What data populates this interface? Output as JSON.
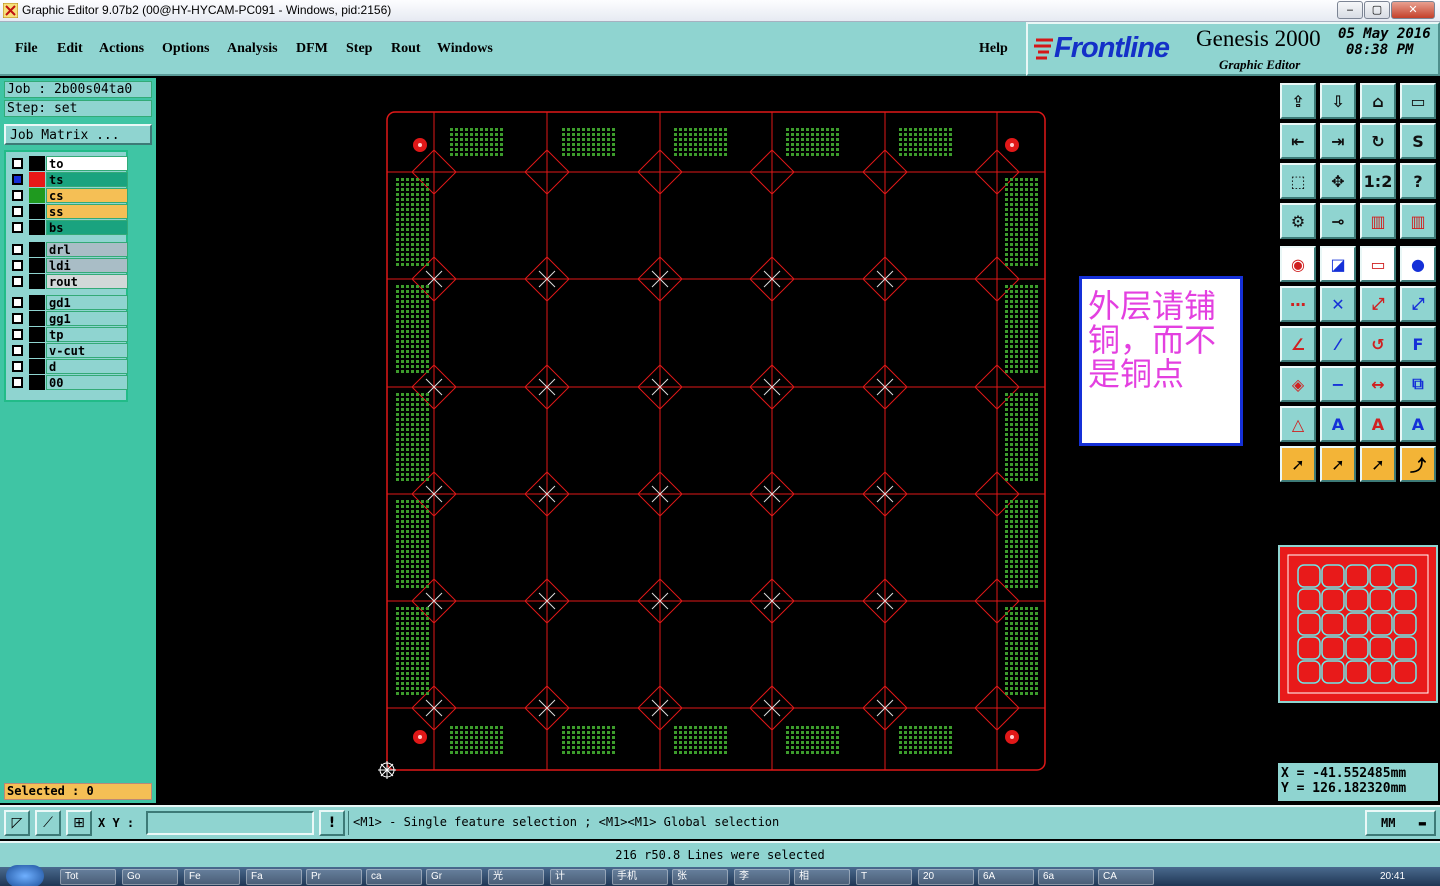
{
  "window": {
    "title": "Graphic Editor 9.07b2 (00@HY-HYCAM-PC091 - Windows, pid:2156)",
    "min": "‒",
    "max": "▢",
    "close": "✕"
  },
  "menu": {
    "items": [
      "File",
      "Edit",
      "Actions",
      "Options",
      "Analysis",
      "DFM",
      "Step",
      "Rout",
      "Windows"
    ],
    "help": "Help"
  },
  "brand": {
    "logo": "Frontline",
    "product": "Genesis 2000",
    "subtitle": "Graphic Editor",
    "date": "05 May 2016",
    "time": "08:38 PM"
  },
  "job": {
    "job_line": "Job : 2b00s04ta0",
    "step_line": "Step: set",
    "matrix_label": "Job Matrix ..."
  },
  "layers": [
    {
      "name": "to",
      "color": "#ffffff",
      "swatch": "#000000"
    },
    {
      "name": "ts",
      "color": "#1aa37f",
      "swatch": "#e81818",
      "active": true
    },
    {
      "name": "cs",
      "color": "#f5bf55",
      "swatch": "#1f9a1f"
    },
    {
      "name": "ss",
      "color": "#f5bf55",
      "swatch": "#000000"
    },
    {
      "name": "bs",
      "color": "#1aa37f",
      "swatch": "#000000"
    },
    {
      "name": "drl",
      "color": "#a9bdc6",
      "swatch": "#000000"
    },
    {
      "name": "ldi",
      "color": "#a9bdc6",
      "swatch": "#000000"
    },
    {
      "name": "rout",
      "color": "#d2d8d8",
      "swatch": "#000000"
    },
    {
      "name": "gd1",
      "color": "#8fd4d0",
      "swatch": "#000000"
    },
    {
      "name": "gg1",
      "color": "#8fd4d0",
      "swatch": "#000000"
    },
    {
      "name": "tp",
      "color": "#8fd4d0",
      "swatch": "#000000"
    },
    {
      "name": "v-cut",
      "color": "#8fd4d0",
      "swatch": "#000000"
    },
    {
      "name": "d",
      "color": "#8fd4d0",
      "swatch": "#000000"
    },
    {
      "name": "00",
      "color": "#8fd4d0",
      "swatch": "#000000"
    }
  ],
  "selected": "Selected : 0",
  "note": {
    "text": "外层请铺铜，而不是铜点"
  },
  "coords": {
    "x": "X = -41.552485mm",
    "y": "Y = 126.182320mm"
  },
  "command": {
    "xy_label": "X Y :",
    "xy_value": "",
    "warn": "!",
    "hint": "<M1> - Single feature selection ; <M1><M1> Global selection",
    "units": "MM"
  },
  "status": "216 r50.8 Lines were selected",
  "toolbar_icons": [
    "home-icon",
    "save-icon",
    "home-step-icon",
    "window-icon",
    "prev-icon",
    "next-icon",
    "swap-icon",
    "s-curve-icon",
    "fit-icon",
    "center-icon",
    "ratio-label",
    "help-icon",
    "settings-icon",
    "snap-icon",
    "layers-red-icon",
    "layers-blue-icon"
  ],
  "toolbar_ratio_text": "1:2",
  "toolbar_help_text": "?",
  "taskbar": [
    "Tot",
    "Go",
    "Fe",
    "Fa",
    "Pr",
    "ca",
    "Gr",
    "光",
    "计",
    "手机",
    "张",
    "李",
    "相",
    "T",
    "20",
    "6A",
    "6a",
    "CA"
  ],
  "taskbar_time": "20:41",
  "colors": {
    "panel": "#8fd4d0",
    "left_bg": "#3fc5a4",
    "board_line": "#e01818",
    "pad_green": "#3d9c2c",
    "note_border": "#1530d8",
    "note_text": "#e340e0"
  }
}
